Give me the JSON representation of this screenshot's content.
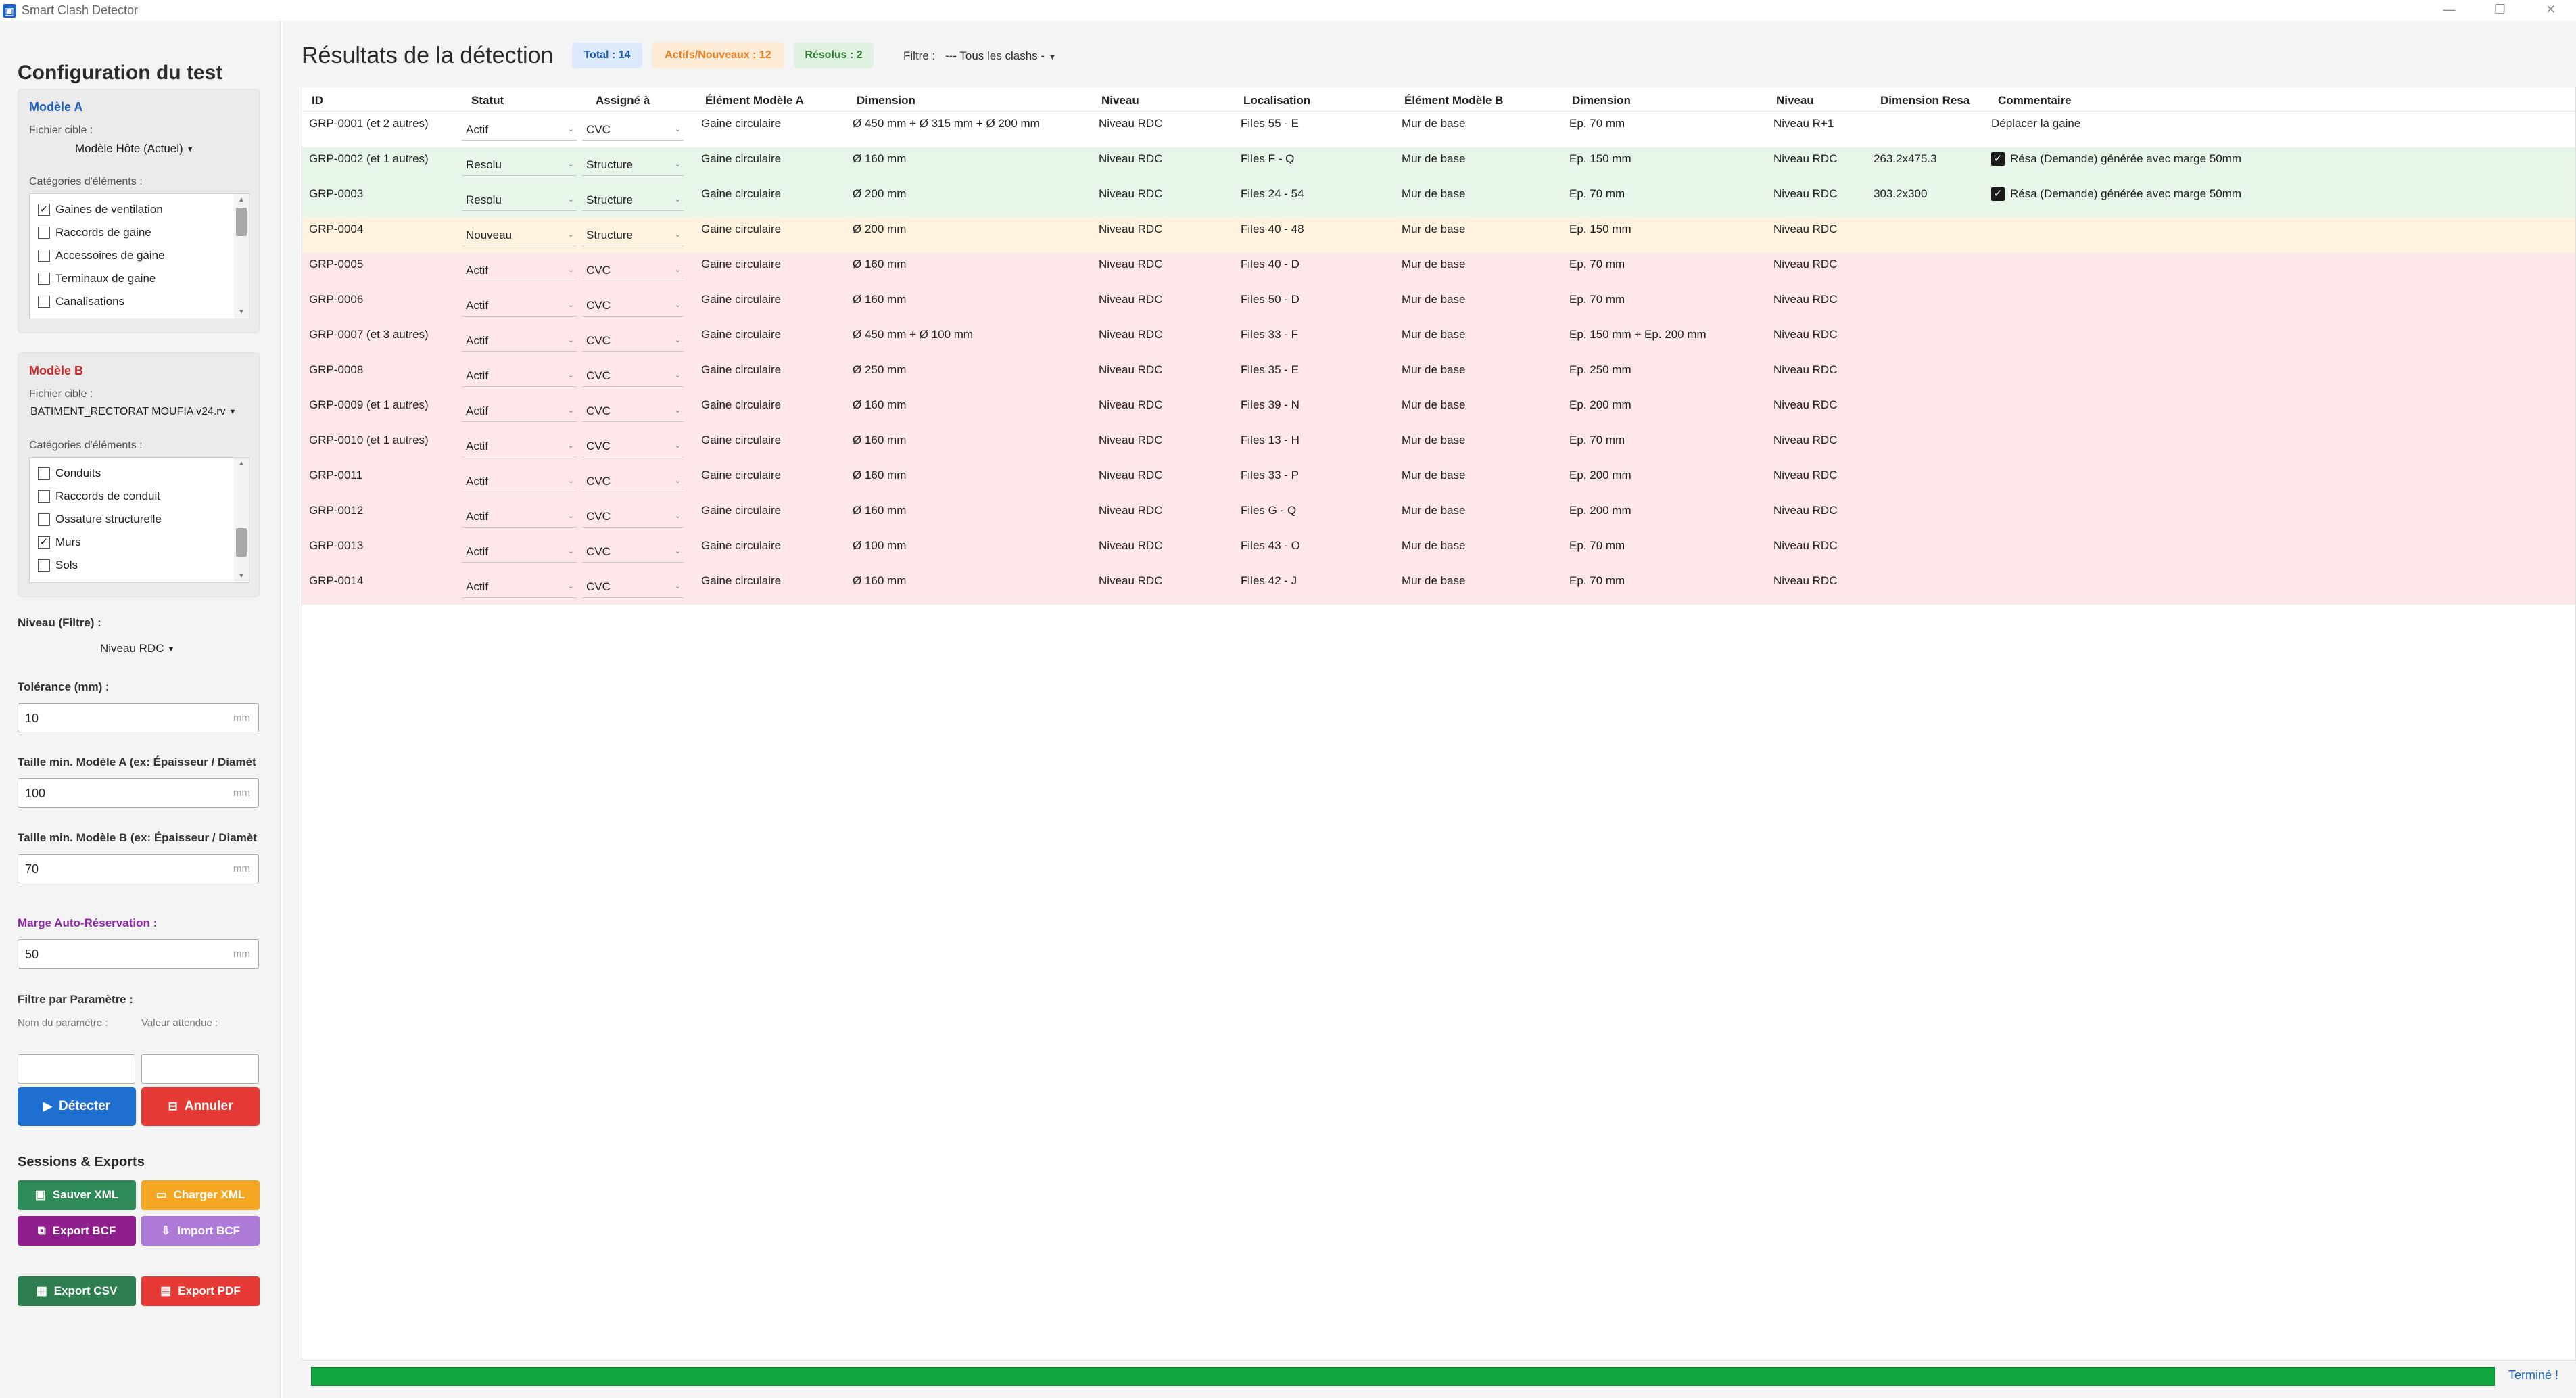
{
  "window": {
    "title": "Smart Clash Detector"
  },
  "sidebar": {
    "title": "Configuration du test",
    "model_a": {
      "title": "Modèle A",
      "title_color": "#1f5fbf",
      "file_label": "Fichier cible :",
      "file_value": "Modèle Hôte (Actuel)",
      "categories_label": "Catégories d'éléments :",
      "categories": [
        {
          "label": "Gaines de ventilation",
          "checked": true
        },
        {
          "label": "Raccords de gaine",
          "checked": false
        },
        {
          "label": "Accessoires de gaine",
          "checked": false
        },
        {
          "label": "Terminaux de gaine",
          "checked": false
        },
        {
          "label": "Canalisations",
          "checked": false
        }
      ]
    },
    "model_b": {
      "title": "Modèle B",
      "title_color": "#c62828",
      "file_label": "Fichier cible :",
      "file_value": "BATIMENT_RECTORAT MOUFIA v24.rv",
      "categories_label": "Catégories d'éléments :",
      "categories": [
        {
          "label": "Conduits",
          "checked": false
        },
        {
          "label": "Raccords de conduit",
          "checked": false
        },
        {
          "label": "Ossature structurelle",
          "checked": false
        },
        {
          "label": "Murs",
          "checked": true
        },
        {
          "label": "Sols",
          "checked": false
        }
      ]
    },
    "level_filter": {
      "label": "Niveau (Filtre) :",
      "value": "Niveau RDC"
    },
    "tolerance": {
      "label": "Tolérance (mm) :",
      "value": "10",
      "unit": "mm"
    },
    "min_size_a": {
      "label": "Taille min. Modèle A (ex: Épaisseur / Diamèt",
      "value": "100",
      "unit": "mm"
    },
    "min_size_b": {
      "label": "Taille min. Modèle B (ex: Épaisseur / Diamèt",
      "value": "70",
      "unit": "mm"
    },
    "auto_margin": {
      "label": "Marge Auto-Réservation :",
      "value": "50",
      "unit": "mm",
      "color": "#8e24aa"
    },
    "param_filter": {
      "label": "Filtre par Paramètre :",
      "name_label": "Nom du paramètre :",
      "value_label": "Valeur attendue :"
    },
    "detect_button": "Détecter",
    "cancel_button": "Annuler",
    "sessions_title": "Sessions & Exports",
    "buttons": {
      "save_xml": "Sauver XML",
      "load_xml": "Charger XML",
      "export_bcf": "Export BCF",
      "import_bcf": "Import BCF",
      "export_csv": "Export CSV",
      "export_pdf": "Export PDF"
    }
  },
  "results": {
    "title": "Résultats de la détection",
    "badges": {
      "total": "Total : 14",
      "active": "Actifs/Nouveaux : 12",
      "resolved": "Résolus : 2"
    },
    "filter_label": "Filtre :",
    "filter_value": "--- Tous les clashs -",
    "columns": [
      "ID",
      "Statut",
      "Assigné à",
      "Élément Modèle A",
      "Dimension",
      "Niveau",
      "Localisation",
      "Élément Modèle B",
      "Dimension",
      "Niveau",
      "Dimension Resa",
      "Commentaire"
    ],
    "rows": [
      {
        "id": "GRP-0001 (et 2 autres)",
        "status": "Actif",
        "assigned": "CVC",
        "elem_a": "Gaine circulaire",
        "dim_a": "Ø 450 mm + Ø 315 mm + Ø 200 mm",
        "level_a": "Niveau RDC",
        "location": "Files 55 - E",
        "elem_b": "Mur de base",
        "dim_b": "Ep. 70 mm",
        "level_b": "Niveau R+1",
        "resa": "",
        "check": false,
        "comment": "Déplacer la gaine",
        "bg": "#ffffff"
      },
      {
        "id": "GRP-0002 (et 1 autres)",
        "status": "Resolu",
        "assigned": "Structure",
        "elem_a": "Gaine circulaire",
        "dim_a": "Ø 160 mm",
        "level_a": "Niveau RDC",
        "location": "Files F - Q",
        "elem_b": "Mur de base",
        "dim_b": "Ep. 150 mm",
        "level_b": "Niveau RDC",
        "resa": "263.2x475.3",
        "check": true,
        "comment": "Résa (Demande) générée avec marge 50mm",
        "bg": "#e8f5e9"
      },
      {
        "id": "GRP-0003",
        "status": "Resolu",
        "assigned": "Structure",
        "elem_a": "Gaine circulaire",
        "dim_a": "Ø 200 mm",
        "level_a": "Niveau RDC",
        "location": "Files 24 - 54",
        "elem_b": "Mur de base",
        "dim_b": "Ep. 70 mm",
        "level_b": "Niveau RDC",
        "resa": "303.2x300",
        "check": true,
        "comment": "Résa (Demande) générée avec marge 50mm",
        "bg": "#e8f5e9"
      },
      {
        "id": "GRP-0004",
        "status": "Nouveau",
        "assigned": "Structure",
        "elem_a": "Gaine circulaire",
        "dim_a": "Ø 200 mm",
        "level_a": "Niveau RDC",
        "location": "Files 40 - 48",
        "elem_b": "Mur de base",
        "dim_b": "Ep. 150 mm",
        "level_b": "Niveau RDC",
        "resa": "",
        "check": false,
        "comment": "",
        "bg": "#fff3e0"
      },
      {
        "id": "GRP-0005",
        "status": "Actif",
        "assigned": "CVC",
        "elem_a": "Gaine circulaire",
        "dim_a": "Ø 160 mm",
        "level_a": "Niveau RDC",
        "location": "Files 40 - D",
        "elem_b": "Mur de base",
        "dim_b": "Ep. 70 mm",
        "level_b": "Niveau RDC",
        "resa": "",
        "check": false,
        "comment": "",
        "bg": "#fde7e9"
      },
      {
        "id": "GRP-0006",
        "status": "Actif",
        "assigned": "CVC",
        "elem_a": "Gaine circulaire",
        "dim_a": "Ø 160 mm",
        "level_a": "Niveau RDC",
        "location": "Files 50 - D",
        "elem_b": "Mur de base",
        "dim_b": "Ep. 70 mm",
        "level_b": "Niveau RDC",
        "resa": "",
        "check": false,
        "comment": "",
        "bg": "#fde7e9"
      },
      {
        "id": "GRP-0007 (et 3 autres)",
        "status": "Actif",
        "assigned": "CVC",
        "elem_a": "Gaine circulaire",
        "dim_a": "Ø 450 mm + Ø 100 mm",
        "level_a": "Niveau RDC",
        "location": "Files 33 - F",
        "elem_b": "Mur de base",
        "dim_b": "Ep. 150 mm + Ep. 200 mm",
        "level_b": "Niveau RDC",
        "resa": "",
        "check": false,
        "comment": "",
        "bg": "#fde7e9"
      },
      {
        "id": "GRP-0008",
        "status": "Actif",
        "assigned": "CVC",
        "elem_a": "Gaine circulaire",
        "dim_a": "Ø 250 mm",
        "level_a": "Niveau RDC",
        "location": "Files 35 - E",
        "elem_b": "Mur de base",
        "dim_b": "Ep. 250 mm",
        "level_b": "Niveau RDC",
        "resa": "",
        "check": false,
        "comment": "",
        "bg": "#fde7e9"
      },
      {
        "id": "GRP-0009 (et 1 autres)",
        "status": "Actif",
        "assigned": "CVC",
        "elem_a": "Gaine circulaire",
        "dim_a": "Ø 160 mm",
        "level_a": "Niveau RDC",
        "location": "Files 39 - N",
        "elem_b": "Mur de base",
        "dim_b": "Ep. 200 mm",
        "level_b": "Niveau RDC",
        "resa": "",
        "check": false,
        "comment": "",
        "bg": "#fde7e9"
      },
      {
        "id": "GRP-0010 (et 1 autres)",
        "status": "Actif",
        "assigned": "CVC",
        "elem_a": "Gaine circulaire",
        "dim_a": "Ø 160 mm",
        "level_a": "Niveau RDC",
        "location": "Files 13 - H",
        "elem_b": "Mur de base",
        "dim_b": "Ep. 70 mm",
        "level_b": "Niveau RDC",
        "resa": "",
        "check": false,
        "comment": "",
        "bg": "#fde7e9"
      },
      {
        "id": "GRP-0011",
        "status": "Actif",
        "assigned": "CVC",
        "elem_a": "Gaine circulaire",
        "dim_a": "Ø 160 mm",
        "level_a": "Niveau RDC",
        "location": "Files 33 - P",
        "elem_b": "Mur de base",
        "dim_b": "Ep. 200 mm",
        "level_b": "Niveau RDC",
        "resa": "",
        "check": false,
        "comment": "",
        "bg": "#fde7e9"
      },
      {
        "id": "GRP-0012",
        "status": "Actif",
        "assigned": "CVC",
        "elem_a": "Gaine circulaire",
        "dim_a": "Ø 160 mm",
        "level_a": "Niveau RDC",
        "location": "Files G - Q",
        "elem_b": "Mur de base",
        "dim_b": "Ep. 200 mm",
        "level_b": "Niveau RDC",
        "resa": "",
        "check": false,
        "comment": "",
        "bg": "#fde7e9"
      },
      {
        "id": "GRP-0013",
        "status": "Actif",
        "assigned": "CVC",
        "elem_a": "Gaine circulaire",
        "dim_a": "Ø 100 mm",
        "level_a": "Niveau RDC",
        "location": "Files 43 - O",
        "elem_b": "Mur de base",
        "dim_b": "Ep. 70 mm",
        "level_b": "Niveau RDC",
        "resa": "",
        "check": false,
        "comment": "",
        "bg": "#fde7e9"
      },
      {
        "id": "GRP-0014",
        "status": "Actif",
        "assigned": "CVC",
        "elem_a": "Gaine circulaire",
        "dim_a": "Ø 160 mm",
        "level_a": "Niveau RDC",
        "location": "Files 42 - J",
        "elem_b": "Mur de base",
        "dim_b": "Ep. 70 mm",
        "level_b": "Niveau RDC",
        "resa": "",
        "check": false,
        "comment": "",
        "bg": "#fde7e9"
      }
    ]
  },
  "progress": {
    "value": 1.0,
    "status": "Terminé !"
  }
}
